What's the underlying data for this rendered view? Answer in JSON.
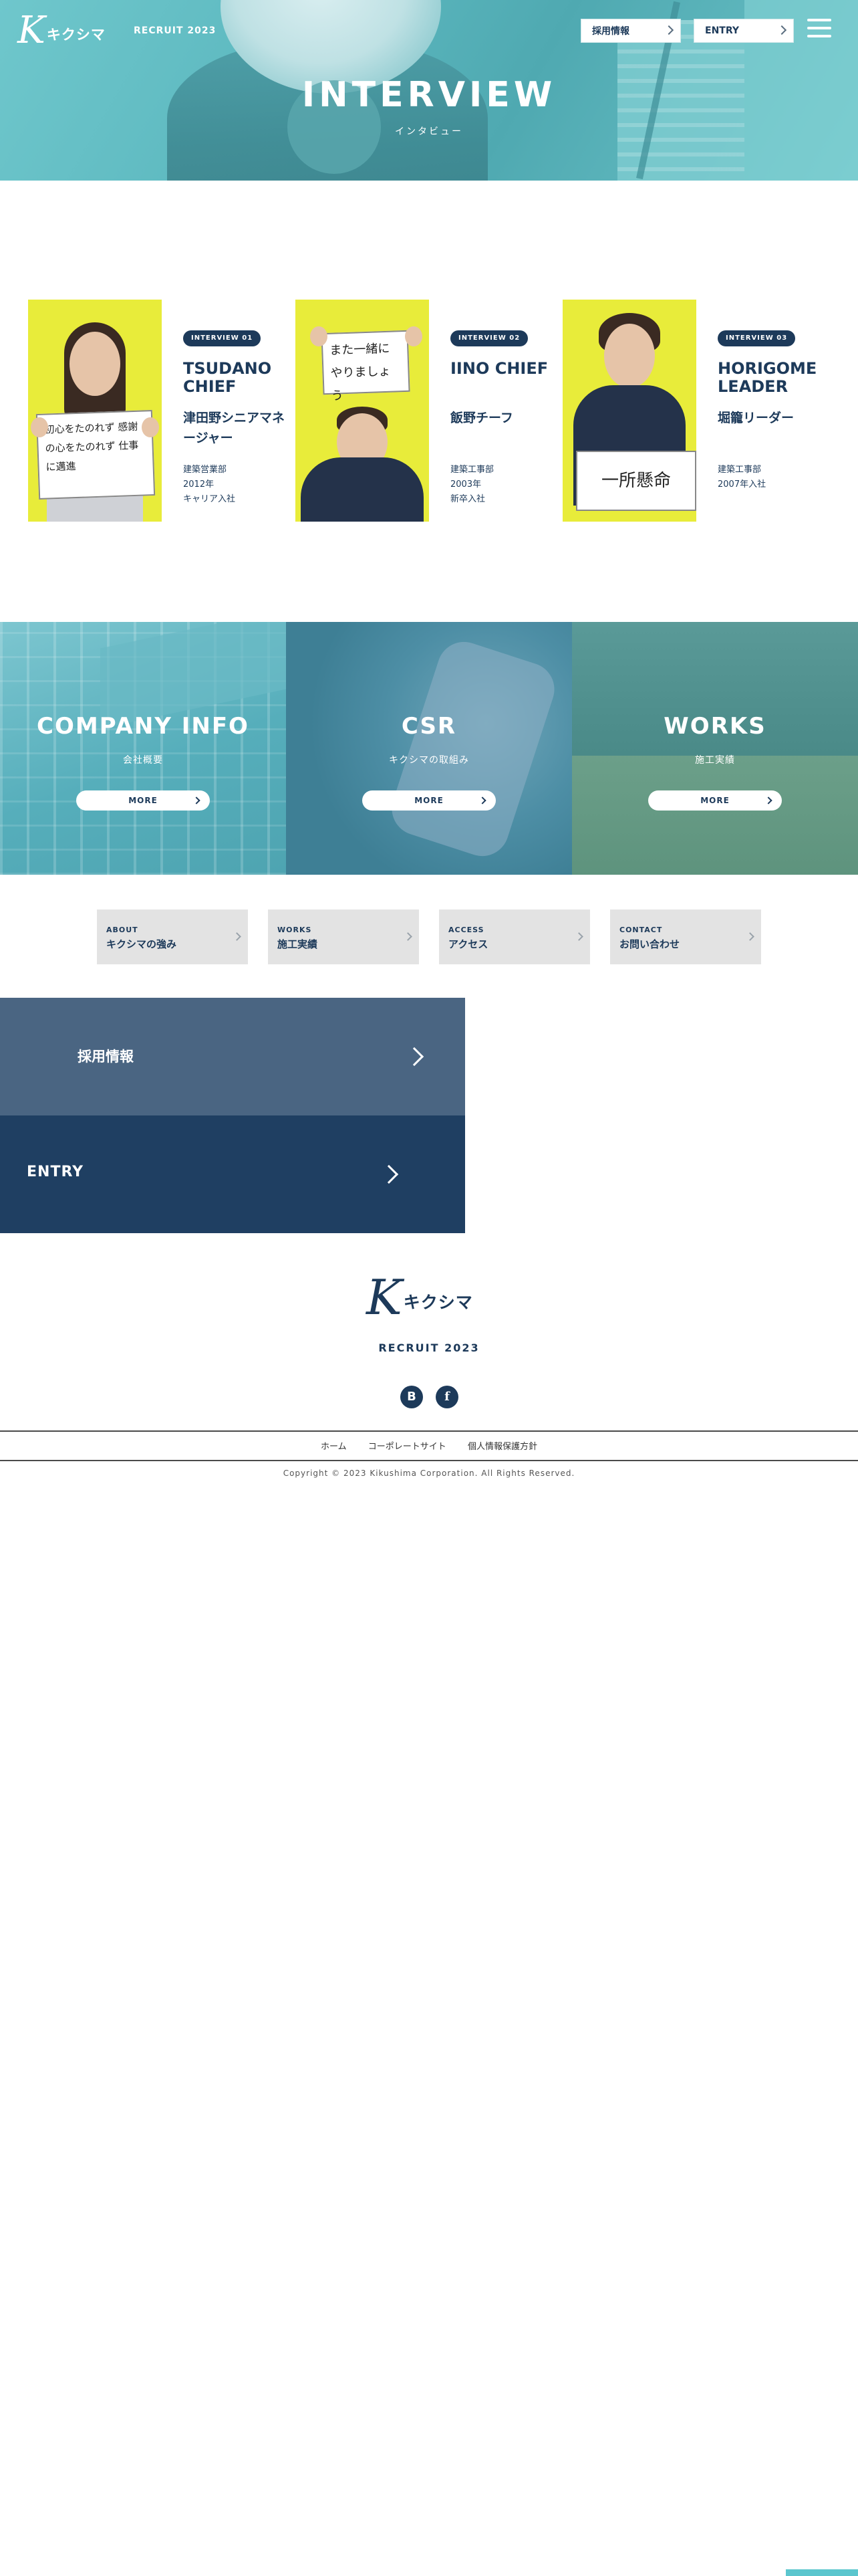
{
  "header": {
    "logo_k": "K",
    "logo_text": "キクシマ",
    "recruit": "RECRUIT 2023",
    "btn_saiyo": "採用情報",
    "btn_entry": "ENTRY"
  },
  "hero": {
    "title": "INTERVIEW",
    "subtitle": "インタビュー"
  },
  "interviews": [
    {
      "tag": "INTERVIEW 01",
      "name_en": "TSUDANO CHIEF",
      "name_jp": "津田野シニアマネージャー",
      "meta": [
        "建築営業部",
        "2012年",
        "キャリア入社"
      ],
      "board": "初心をたのれず 感謝の心をたのれず 仕事に邁進"
    },
    {
      "tag": "INTERVIEW 02",
      "name_en": "IINO CHIEF",
      "name_jp": "飯野チーフ",
      "meta": [
        "建築工事部",
        "2003年",
        "新卒入社"
      ],
      "board": "また一緒に やりましょう"
    },
    {
      "tag": "INTERVIEW 03",
      "name_en": "HORIGOME LEADER",
      "name_jp": "堀籠リーダー",
      "meta": [
        "建築工事部",
        "2007年入社"
      ],
      "board": "一所懸命"
    }
  ],
  "panels": [
    {
      "title": "COMPANY INFO",
      "subtitle": "会社概要",
      "more": "MORE"
    },
    {
      "title": "CSR",
      "subtitle": "キクシマの取組み",
      "more": "MORE"
    },
    {
      "title": "WORKS",
      "subtitle": "施工実績",
      "more": "MORE"
    }
  ],
  "links": [
    {
      "en": "ABOUT",
      "jp": "キクシマの強み"
    },
    {
      "en": "WORKS",
      "jp": "施工実績"
    },
    {
      "en": "ACCESS",
      "jp": "アクセス"
    },
    {
      "en": "CONTACT",
      "jp": "お問い合わせ"
    }
  ],
  "blocks": {
    "saiyo": "採用情報",
    "entry": "ENTRY"
  },
  "footer": {
    "logo_k": "K",
    "logo_text": "キクシマ",
    "recruit": "RECRUIT 2023",
    "social_b": "B",
    "social_f": "f",
    "nav": [
      "ホーム",
      "コーポレートサイト",
      "個人情報保護方針"
    ],
    "copyright": "Copyright © 2023 Kikushima Corporation. All Rights Reserved."
  },
  "colors": {
    "navy": "#1d3a5a",
    "teal": "#5cb8bf",
    "photo_bg": "#e8ec3a",
    "block_light": "#4a6582",
    "block_dark": "#1f3f62"
  }
}
